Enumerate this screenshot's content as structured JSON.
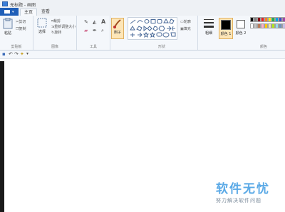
{
  "window": {
    "title": "无标题 - 画图"
  },
  "tabs": [
    {
      "label": "主页"
    },
    {
      "label": "查看"
    }
  ],
  "groups": {
    "clipboard": {
      "label": "剪贴板",
      "paste": "粘贴",
      "cut": "剪切",
      "copy": "复制"
    },
    "image": {
      "label": "图像",
      "select": "选择",
      "crop": "裁剪",
      "resize": "重新调整大小",
      "rotate": "旋转"
    },
    "tools": {
      "label": "工具"
    },
    "brushes": {
      "label": "刷子"
    },
    "shapes": {
      "label": "形状",
      "outline": "轮廓",
      "fill": "填充"
    },
    "size": {
      "label": "粗细"
    },
    "color1": {
      "label": "颜色 1",
      "color": "#000000"
    },
    "color2": {
      "label": "颜色 2",
      "color": "#ffffff"
    },
    "colors": {
      "label": "颜色",
      "palette": [
        "#000000",
        "#7f7f7f",
        "#880015",
        "#ed1c24",
        "#ff7f27",
        "#fff200",
        "#22b14c",
        "#00a2e8",
        "#3f48cc",
        "#a349a4",
        "#ffffff",
        "#c3c3c3",
        "#b97a57",
        "#ffaec9",
        "#ffc90e",
        "#efe4b0",
        "#b5e61d",
        "#99d9ea",
        "#7092be",
        "#c8bfe7"
      ]
    }
  },
  "watermark": {
    "title": "软件无忧",
    "subtitle": "努力解决软件问题"
  }
}
